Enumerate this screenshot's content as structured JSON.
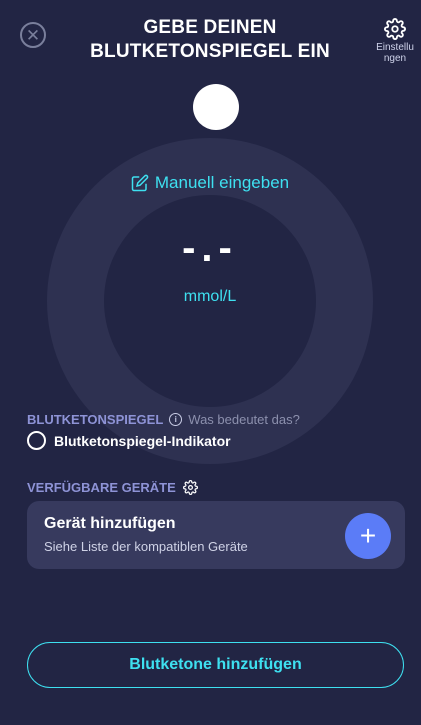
{
  "header": {
    "title_line1": "GEBE DEINEN",
    "title_line2": "BLUTKETONSPIEGEL EIN",
    "settings_label_line1": "Einstellu",
    "settings_label_line2": "ngen",
    "close_icon": "close-icon",
    "settings_icon": "gear-icon"
  },
  "dial": {
    "manual_label": "Manuell eingeben",
    "value": "-.-",
    "unit": "mmol/L"
  },
  "ketone_section": {
    "title": "BLUTKETONSPIEGEL",
    "info_link": "Was bedeutet das?",
    "indicator_label": "Blutketonspiegel-Indikator"
  },
  "devices_section": {
    "title": "VERFÜGBARE GERÄTE",
    "card_title": "Gerät hinzufügen",
    "card_subtitle": "Siehe Liste der kompatiblen Geräte"
  },
  "primary_button": "Blutketone hinzufügen",
  "colors": {
    "background": "#222544",
    "accent": "#3ee0f0",
    "add_button": "#5b7cf7",
    "section_title": "#8e93d6"
  }
}
